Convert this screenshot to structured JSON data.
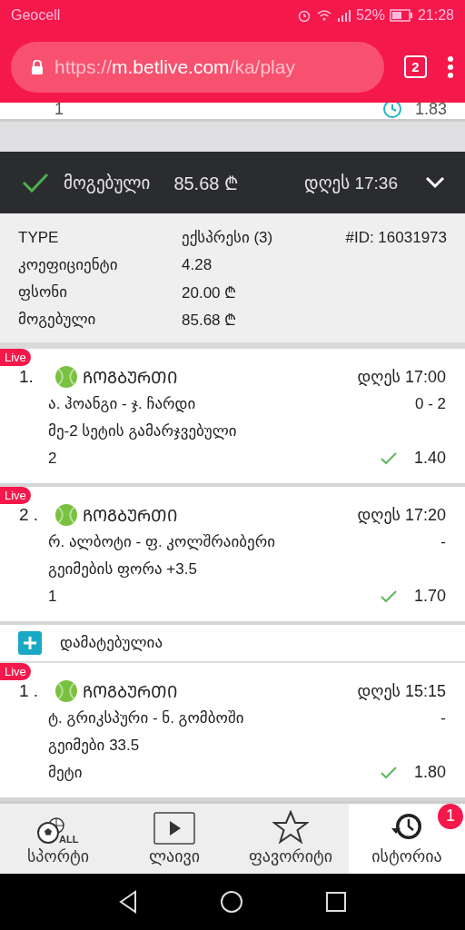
{
  "status_bar": {
    "carrier": "Geocell",
    "battery": "52%",
    "time": "21:28"
  },
  "browser": {
    "url_scheme": "https://",
    "url_host": "m.betlive.com",
    "url_path": "/ka/play",
    "tab_count": "2"
  },
  "previous_row": {
    "pick": "1",
    "odds": "1.83"
  },
  "ticket": {
    "won": true,
    "status": "მოგებული",
    "amount": "85.68 ₾",
    "time": "დღეს 17:36",
    "expanded": true
  },
  "details": [
    {
      "label": "TYPE",
      "value": "ექსპრესი (3)",
      "extra": "#ID: 16031973"
    },
    {
      "label": "კოეფიციენტი",
      "value": "4.28"
    },
    {
      "label": "ფსონი",
      "value": "20.00 ₾"
    },
    {
      "label": "მოგებული",
      "value": "85.68 ₾"
    }
  ],
  "bets": [
    {
      "live": true,
      "badge": "Live",
      "number": "1.",
      "sport": "ᲩᲝᲒᲑᲣᲠᲗᲘ",
      "time": "დღეს 17:00",
      "players": "ა. ჰოანგი - ჯ. ჩარდი",
      "score": "0 - 2",
      "market": "მე-2 სეტის გამარჯვებული",
      "pick": "2",
      "won": true,
      "odds": "1.40"
    },
    {
      "live": true,
      "badge": "Live",
      "number": "2 .",
      "sport": "ᲩᲝᲒᲑᲣᲠᲗᲘ",
      "time": "დღეს 17:20",
      "players": "რ. ალბოტი - ფ. კოლშრაიბერი",
      "score": "-",
      "market": "გეიმების ფორა +3.5",
      "pick": "1",
      "won": true,
      "odds": "1.70"
    }
  ],
  "added": {
    "label": "დამატებულია",
    "bets": [
      {
        "live": true,
        "badge": "Live",
        "number": "1 .",
        "sport": "ᲩᲝᲒᲑᲣᲠᲗᲘ",
        "time": "დღეს 15:15",
        "players": "ტ. გრიკსპური - ნ. გომბოში",
        "score": "-",
        "market": "გეიმები 33.5",
        "pick": "მეტი",
        "won": true,
        "odds": "1.80"
      }
    ]
  },
  "nav": [
    {
      "kind": "sports",
      "icon_text": "ALL",
      "label": "სპორტი",
      "selected": false
    },
    {
      "kind": "live",
      "label": "ლაივი",
      "selected": false
    },
    {
      "kind": "favorites",
      "label": "ფავორიტი",
      "selected": false
    },
    {
      "kind": "history",
      "label": "ისტორია",
      "selected": true,
      "badge": "1"
    }
  ]
}
